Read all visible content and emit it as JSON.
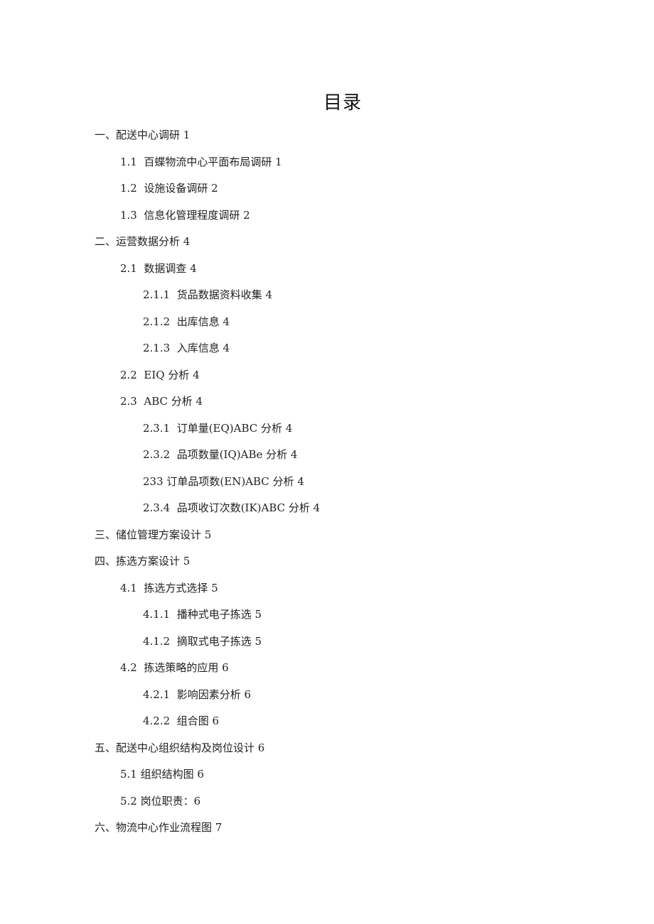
{
  "title": "目录",
  "toc": [
    {
      "level": 1,
      "text": "一、配送中心调研 1"
    },
    {
      "level": 2,
      "text": "1.1  百蝶物流中心平面布局调研 1"
    },
    {
      "level": 2,
      "text": "1.2  设施设备调研 2"
    },
    {
      "level": 2,
      "text": "1.3  信息化管理程度调研 2"
    },
    {
      "level": 1,
      "text": "二、运营数据分析 4"
    },
    {
      "level": 2,
      "text": "2.1  数据调查 4"
    },
    {
      "level": 3,
      "text": "2.1.1  货品数据资料收集 4"
    },
    {
      "level": 3,
      "text": "2.1.2  出库信息 4"
    },
    {
      "level": 3,
      "text": "2.1.3  入库信息 4"
    },
    {
      "level": 2,
      "text": "2.2  EIQ 分析 4"
    },
    {
      "level": 2,
      "text": "2.3  ABC 分析 4"
    },
    {
      "level": 3,
      "text": "2.3.1  订单量(EQ)ABC 分析 4"
    },
    {
      "level": 3,
      "text": "2.3.2  品项数量(IQ)ABe 分析 4"
    },
    {
      "level": 3,
      "text": "233 订单品项数(EN)ABC 分析 4"
    },
    {
      "level": 3,
      "text": "2.3.4  品项收订次数(IK)ABC 分析 4"
    },
    {
      "level": 1,
      "text": "三、储位管理方案设计 5"
    },
    {
      "level": 1,
      "text": "四、拣选方案设计 5"
    },
    {
      "level": 2,
      "text": "4.1  拣选方式选择 5"
    },
    {
      "level": 3,
      "text": "4.1.1  播种式电子拣选 5"
    },
    {
      "level": 3,
      "text": "4.1.2  摘取式电子拣选 5"
    },
    {
      "level": 2,
      "text": "4.2  拣选策略的应用 6"
    },
    {
      "level": 3,
      "text": "4.2.1  影响因素分析 6"
    },
    {
      "level": 3,
      "text": "4.2.2  组合图 6"
    },
    {
      "level": 1,
      "text": "五、配送中心组织结构及岗位设计 6"
    },
    {
      "level": 2,
      "text": "5.1 组织结构图 6"
    },
    {
      "level": 2,
      "text": "5.2 岗位职责：6"
    },
    {
      "level": 1,
      "text": "六、物流中心作业流程图 7"
    }
  ]
}
